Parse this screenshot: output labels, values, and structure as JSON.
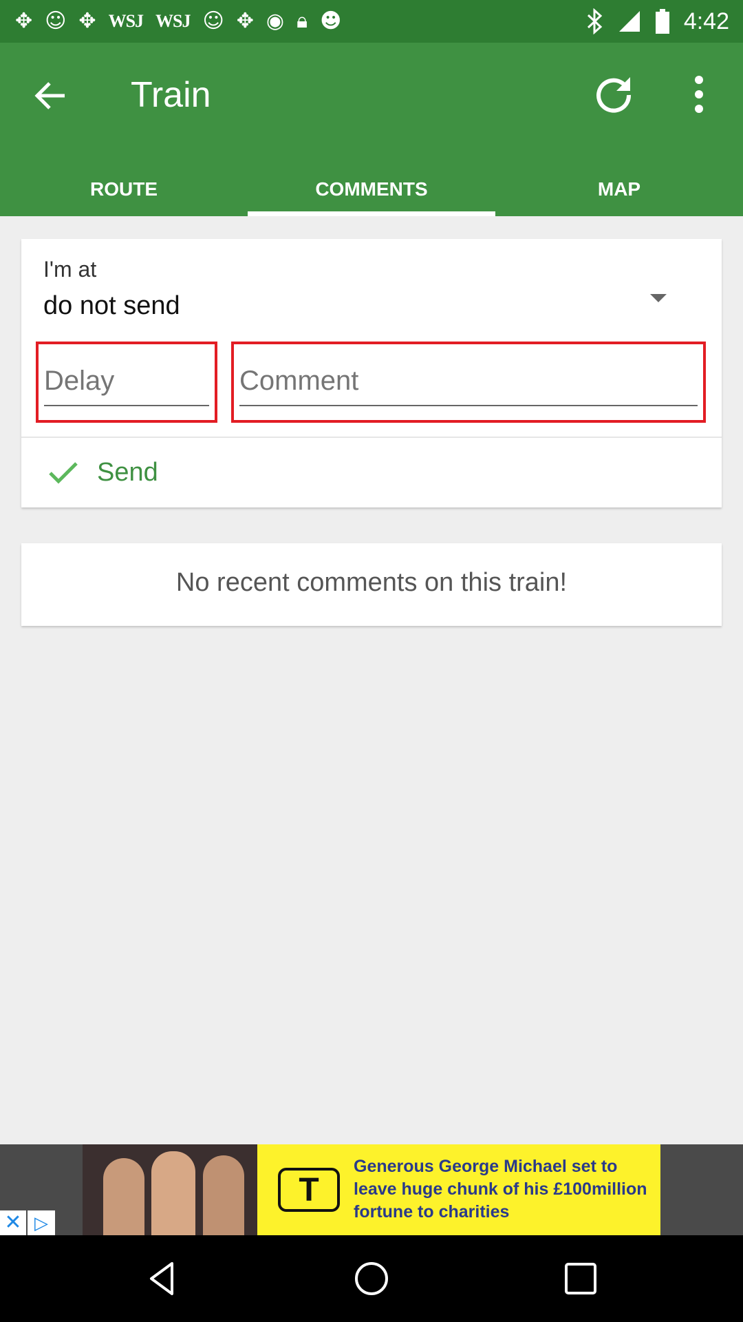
{
  "status_bar": {
    "icons": [
      "pinwheel-icon",
      "smiley-icon",
      "pinwheel-icon",
      "wsj-text",
      "wsj-text",
      "smiley-icon",
      "pinwheel-icon",
      "pulse-icon",
      "lock-icon",
      "face-icon"
    ],
    "wsj_1": "WSJ",
    "wsj_2": "WSJ",
    "time": "4:42"
  },
  "app_bar": {
    "title": "Train",
    "color": "#3f9142"
  },
  "tabs": [
    {
      "label": "ROUTE",
      "active": false
    },
    {
      "label": "COMMENTS",
      "active": true
    },
    {
      "label": "MAP",
      "active": false
    }
  ],
  "location": {
    "label": "I'm at",
    "value": "do not send"
  },
  "delay_field": {
    "placeholder": "Delay",
    "value": ""
  },
  "comment_field": {
    "placeholder": "Comment",
    "value": ""
  },
  "send_label": "Send",
  "empty_message": "No recent comments on this train!",
  "ad": {
    "logo": "T",
    "headline": "Generous George Michael set to leave huge chunk of his £100million fortune to charities",
    "close_glyph": "✕",
    "play_glyph": "▷"
  },
  "colors": {
    "status_bar": "#2e7d32",
    "app_bar": "#3f9142",
    "highlight_border": "#e21d24",
    "send_text": "#3f9142",
    "ad_banner": "#fdf22b"
  }
}
